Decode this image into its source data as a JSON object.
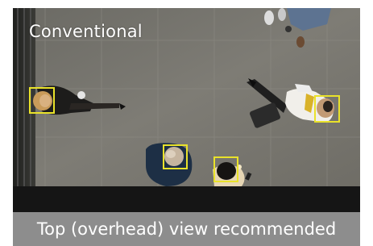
{
  "scene": {
    "label": "Conventional",
    "detection_box_color": "#e9e22a",
    "detected_faces": 4
  },
  "caption": {
    "text": "Top (overhead) view recommended"
  }
}
